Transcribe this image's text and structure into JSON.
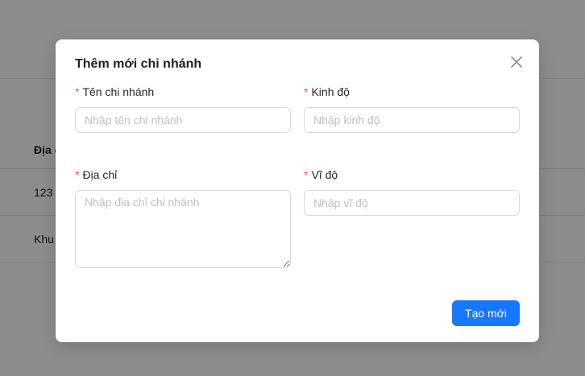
{
  "background": {
    "table": {
      "header_cell": "Địa c",
      "rows": [
        "123",
        "Khu"
      ]
    }
  },
  "modal": {
    "title": "Thêm mới chi nhánh",
    "close_icon": "close-icon",
    "required_mark": "*",
    "fields": {
      "branch_name": {
        "label": "Tên chi nhánh",
        "placeholder": "Nhập tên chi nhánh",
        "value": ""
      },
      "longitude": {
        "label": "Kinh độ",
        "placeholder": "Nhập kinh độ",
        "value": ""
      },
      "address": {
        "label": "Địa chỉ",
        "placeholder": "Nhập địa chỉ chi nhánh",
        "value": ""
      },
      "latitude": {
        "label": "Vĩ độ",
        "placeholder": "Nhập vĩ độ",
        "value": ""
      }
    },
    "submit_label": "Tạo mới"
  },
  "colors": {
    "primary": "#1677ff",
    "required": "#ff4d4f",
    "border": "#d9d9d9",
    "placeholder": "#bfbfbf",
    "overlay": "rgba(0,0,0,0.45)"
  }
}
